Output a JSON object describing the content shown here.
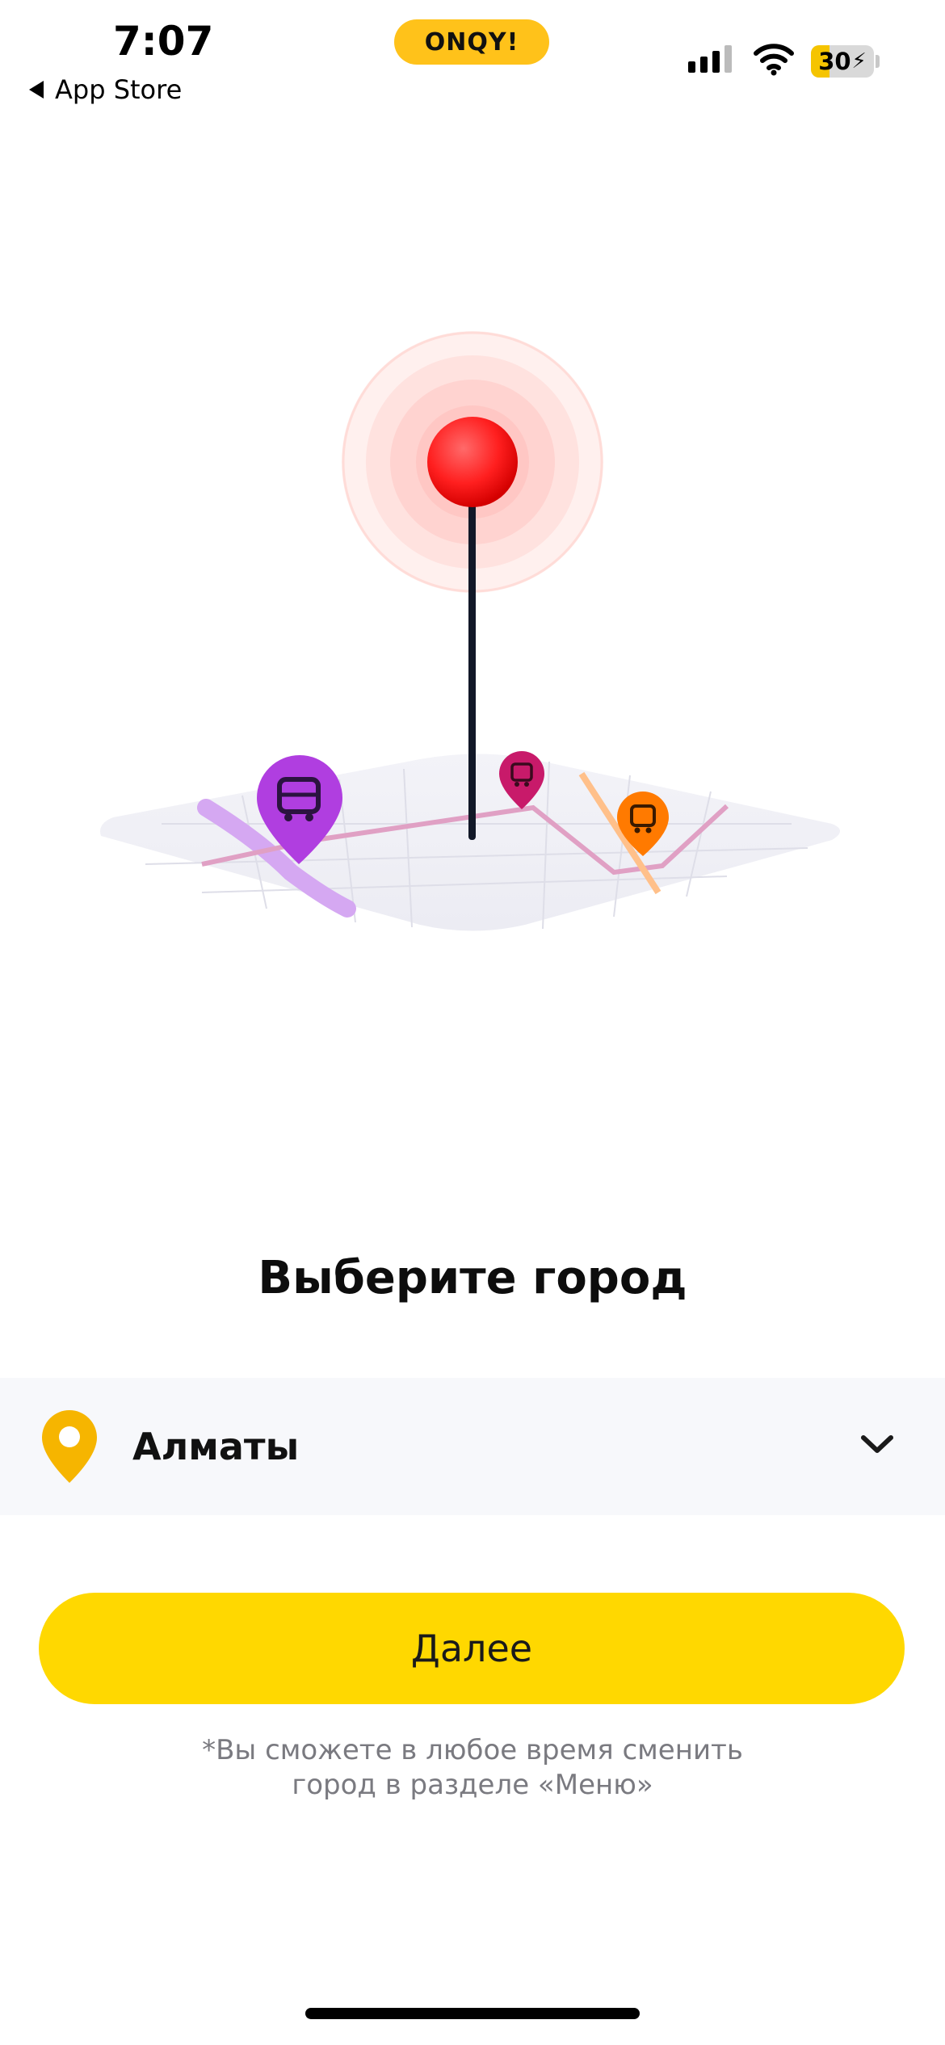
{
  "status_bar": {
    "time": "7:07",
    "back_label": "App Store",
    "brand": "ONQY!",
    "battery_level": "30",
    "battery_fraction": 0.3,
    "signal_icon": "signal-bars-icon",
    "wifi_icon": "wifi-icon"
  },
  "illustration": {
    "icons": [
      "location-target-icon",
      "bus-pin-icon",
      "bus-pin-icon",
      "bus-pin-icon"
    ]
  },
  "main": {
    "title": "Выберите город",
    "city": {
      "selected": "Алматы",
      "icon": "location-pin-icon",
      "dropdown_icon": "chevron-down-icon"
    },
    "next_label": "Далее",
    "note_line1": "*Вы сможете в любое время сменить",
    "note_line2": "город в разделе «Меню»"
  },
  "colors": {
    "accent": "#ffd800",
    "brand_pill": "#ffc21a",
    "pin_yellow": "#f6b500",
    "target_red": "#ff1f1f",
    "bus_purple": "#b03ee0",
    "bus_magenta": "#c81a6a",
    "bus_orange": "#ff7a00"
  }
}
